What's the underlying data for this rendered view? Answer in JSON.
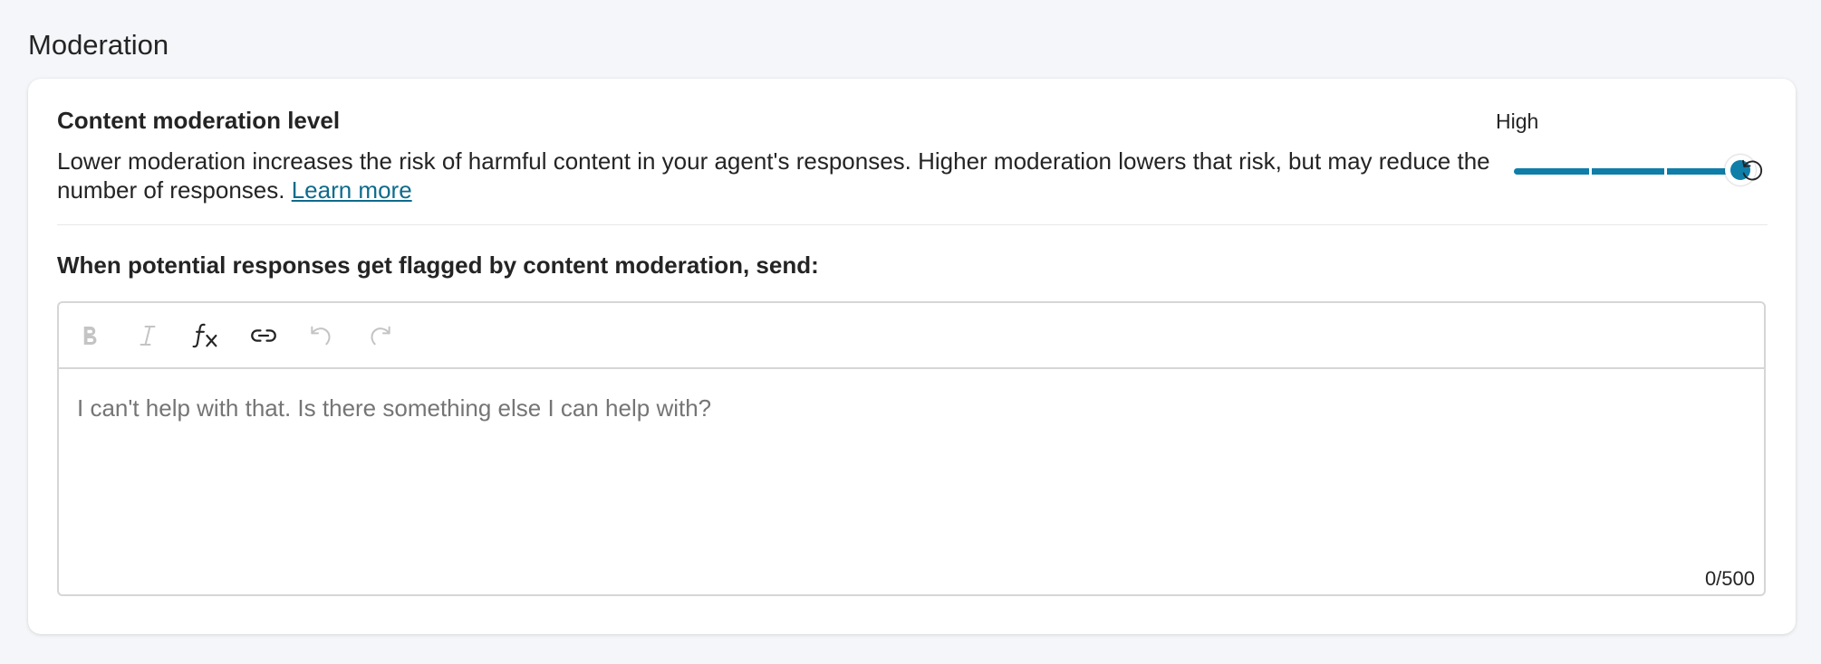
{
  "section": {
    "title": "Moderation"
  },
  "moderation_level": {
    "title": "Content moderation level",
    "description": "Lower moderation increases the risk of harmful content in your agent's responses. Higher moderation lowers that risk, but may reduce the number of responses. ",
    "learn_more": "Learn more",
    "slider": {
      "label": "High",
      "value_fraction": 1.0,
      "steps": 3,
      "accent_color": "#0f7ea8"
    },
    "reset_icon": "reset-icon"
  },
  "flagged": {
    "title": "When potential responses get flagged by content moderation, send:",
    "editor": {
      "toolbar": [
        {
          "name": "bold",
          "icon": "bold-icon",
          "enabled": false
        },
        {
          "name": "italic",
          "icon": "italic-icon",
          "enabled": false
        },
        {
          "name": "formula",
          "icon": "fx-icon",
          "enabled": true
        },
        {
          "name": "link",
          "icon": "link-icon",
          "enabled": true
        },
        {
          "name": "undo",
          "icon": "undo-icon",
          "enabled": false
        },
        {
          "name": "redo",
          "icon": "redo-icon",
          "enabled": false
        }
      ],
      "placeholder": "I can't help with that. Is there something else I can help with?",
      "value": "",
      "char_count": "0/500"
    }
  }
}
